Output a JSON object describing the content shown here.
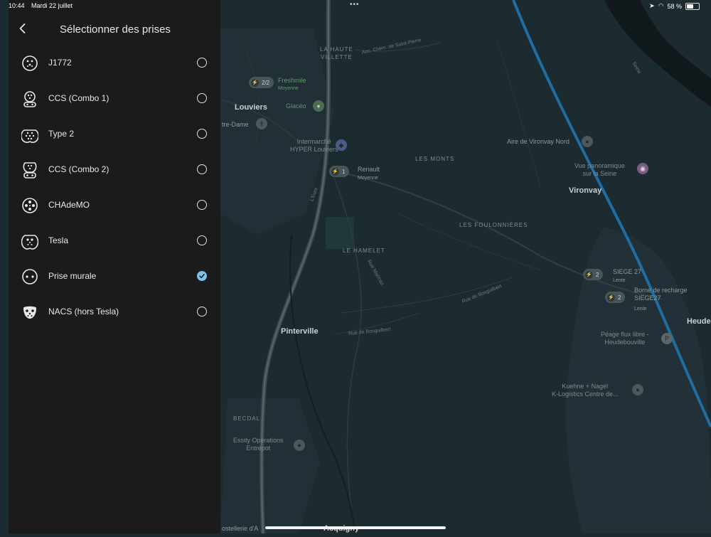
{
  "status_bar": {
    "time": "10:44",
    "date": "Mardi 22 juillet",
    "dots": "•••",
    "battery_percent": "58 %",
    "battery_level": 0.58
  },
  "panel": {
    "title": "Sélectionner des prises",
    "back_icon": "chevron-left-icon",
    "plugs": [
      {
        "label": "J1772",
        "icon": "j1772-plug-icon",
        "selected": false
      },
      {
        "label": "CCS (Combo 1)",
        "icon": "ccs1-plug-icon",
        "selected": false
      },
      {
        "label": "Type 2",
        "icon": "type2-plug-icon",
        "selected": false
      },
      {
        "label": "CCS (Combo 2)",
        "icon": "ccs2-plug-icon",
        "selected": false
      },
      {
        "label": "CHAdeMO",
        "icon": "chademo-plug-icon",
        "selected": false
      },
      {
        "label": "Tesla",
        "icon": "tesla-plug-icon",
        "selected": false
      },
      {
        "label": "Prise murale",
        "icon": "wall-plug-icon",
        "selected": true
      },
      {
        "label": "NACS (hors Tesla)",
        "icon": "nacs-plug-icon",
        "selected": false
      }
    ]
  },
  "map": {
    "labels": {
      "la_haute_villette": "LA HAUTE\nVILLETTE",
      "chem_saint_pierre": "Anc. Chem. de Saint-Pierre",
      "freshmile": "Freshmile",
      "freshmile_sub": "Moyenne",
      "glaceo": "Glacéo",
      "louviers": "Louviers",
      "notre_dame": "tre-Dame",
      "intermarche": "Intermarché\nHYPER Louviers",
      "renault": "Renault",
      "renault_sub": "Moyenne",
      "les_monts": "LES MONTS",
      "aire_vironvay": "Aire de Vironvay Nord",
      "vue_panoramique": "Vue panoramique\nsur la Seine",
      "vironvay": "Vironvay",
      "les_foulonnieres": "LES FOULONNIÈRES",
      "le_hamelet": "LE HAMELET",
      "siege27": "SIEGE 27",
      "siege27_sub": "Lente",
      "borne": "Borne de recharge\nSIEGE27",
      "borne_sub": "Lente",
      "rue_bosguilbert_1": "Rue de Bosguilbert",
      "rue_bosguilbert_2": "Rue de Bosguilbert",
      "rue_marmaz": "Rue Marmaz",
      "leure": "L'Eure",
      "pinterville": "Pinterville",
      "peage": "Péage flux libre -\nHeudebouville",
      "heude": "Heude",
      "kuehne": "Kuehne + Nagel\nK-Logistics Centre de...",
      "becdal": "BECDAL",
      "essity": "Essity Operations\nEntrepot",
      "hostellerie": "ostellerie d'A",
      "acquigny": "Acquigny",
      "seine": "Seine"
    },
    "ev_badges": {
      "freshmile": "2/2",
      "renault": "1",
      "siege27": "2",
      "borne": "2"
    }
  },
  "colors": {
    "map_bg": "#1c2b30",
    "panel_bg": "#1b1b1b",
    "accent": "#78c4e8",
    "highway": "#1f6da1"
  }
}
